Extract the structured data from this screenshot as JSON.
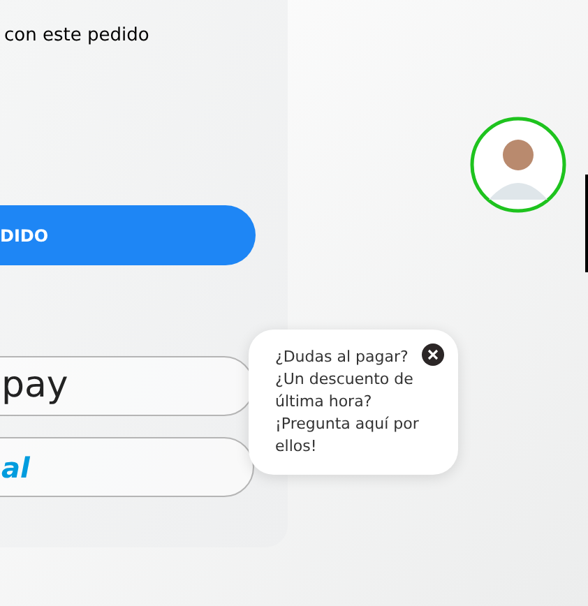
{
  "order_panel": {
    "note": "con este pedido",
    "checkout_button": {
      "label": "DIDO"
    },
    "payment_buttons": [
      {
        "kind": "apple_pay",
        "label": "pay"
      },
      {
        "kind": "paypal",
        "label": "al"
      }
    ]
  },
  "chat_widget": {
    "message": "¿Dudas al pagar? ¿Un descuento de última hora? ¡Pregunta aquí por ellos!"
  }
}
